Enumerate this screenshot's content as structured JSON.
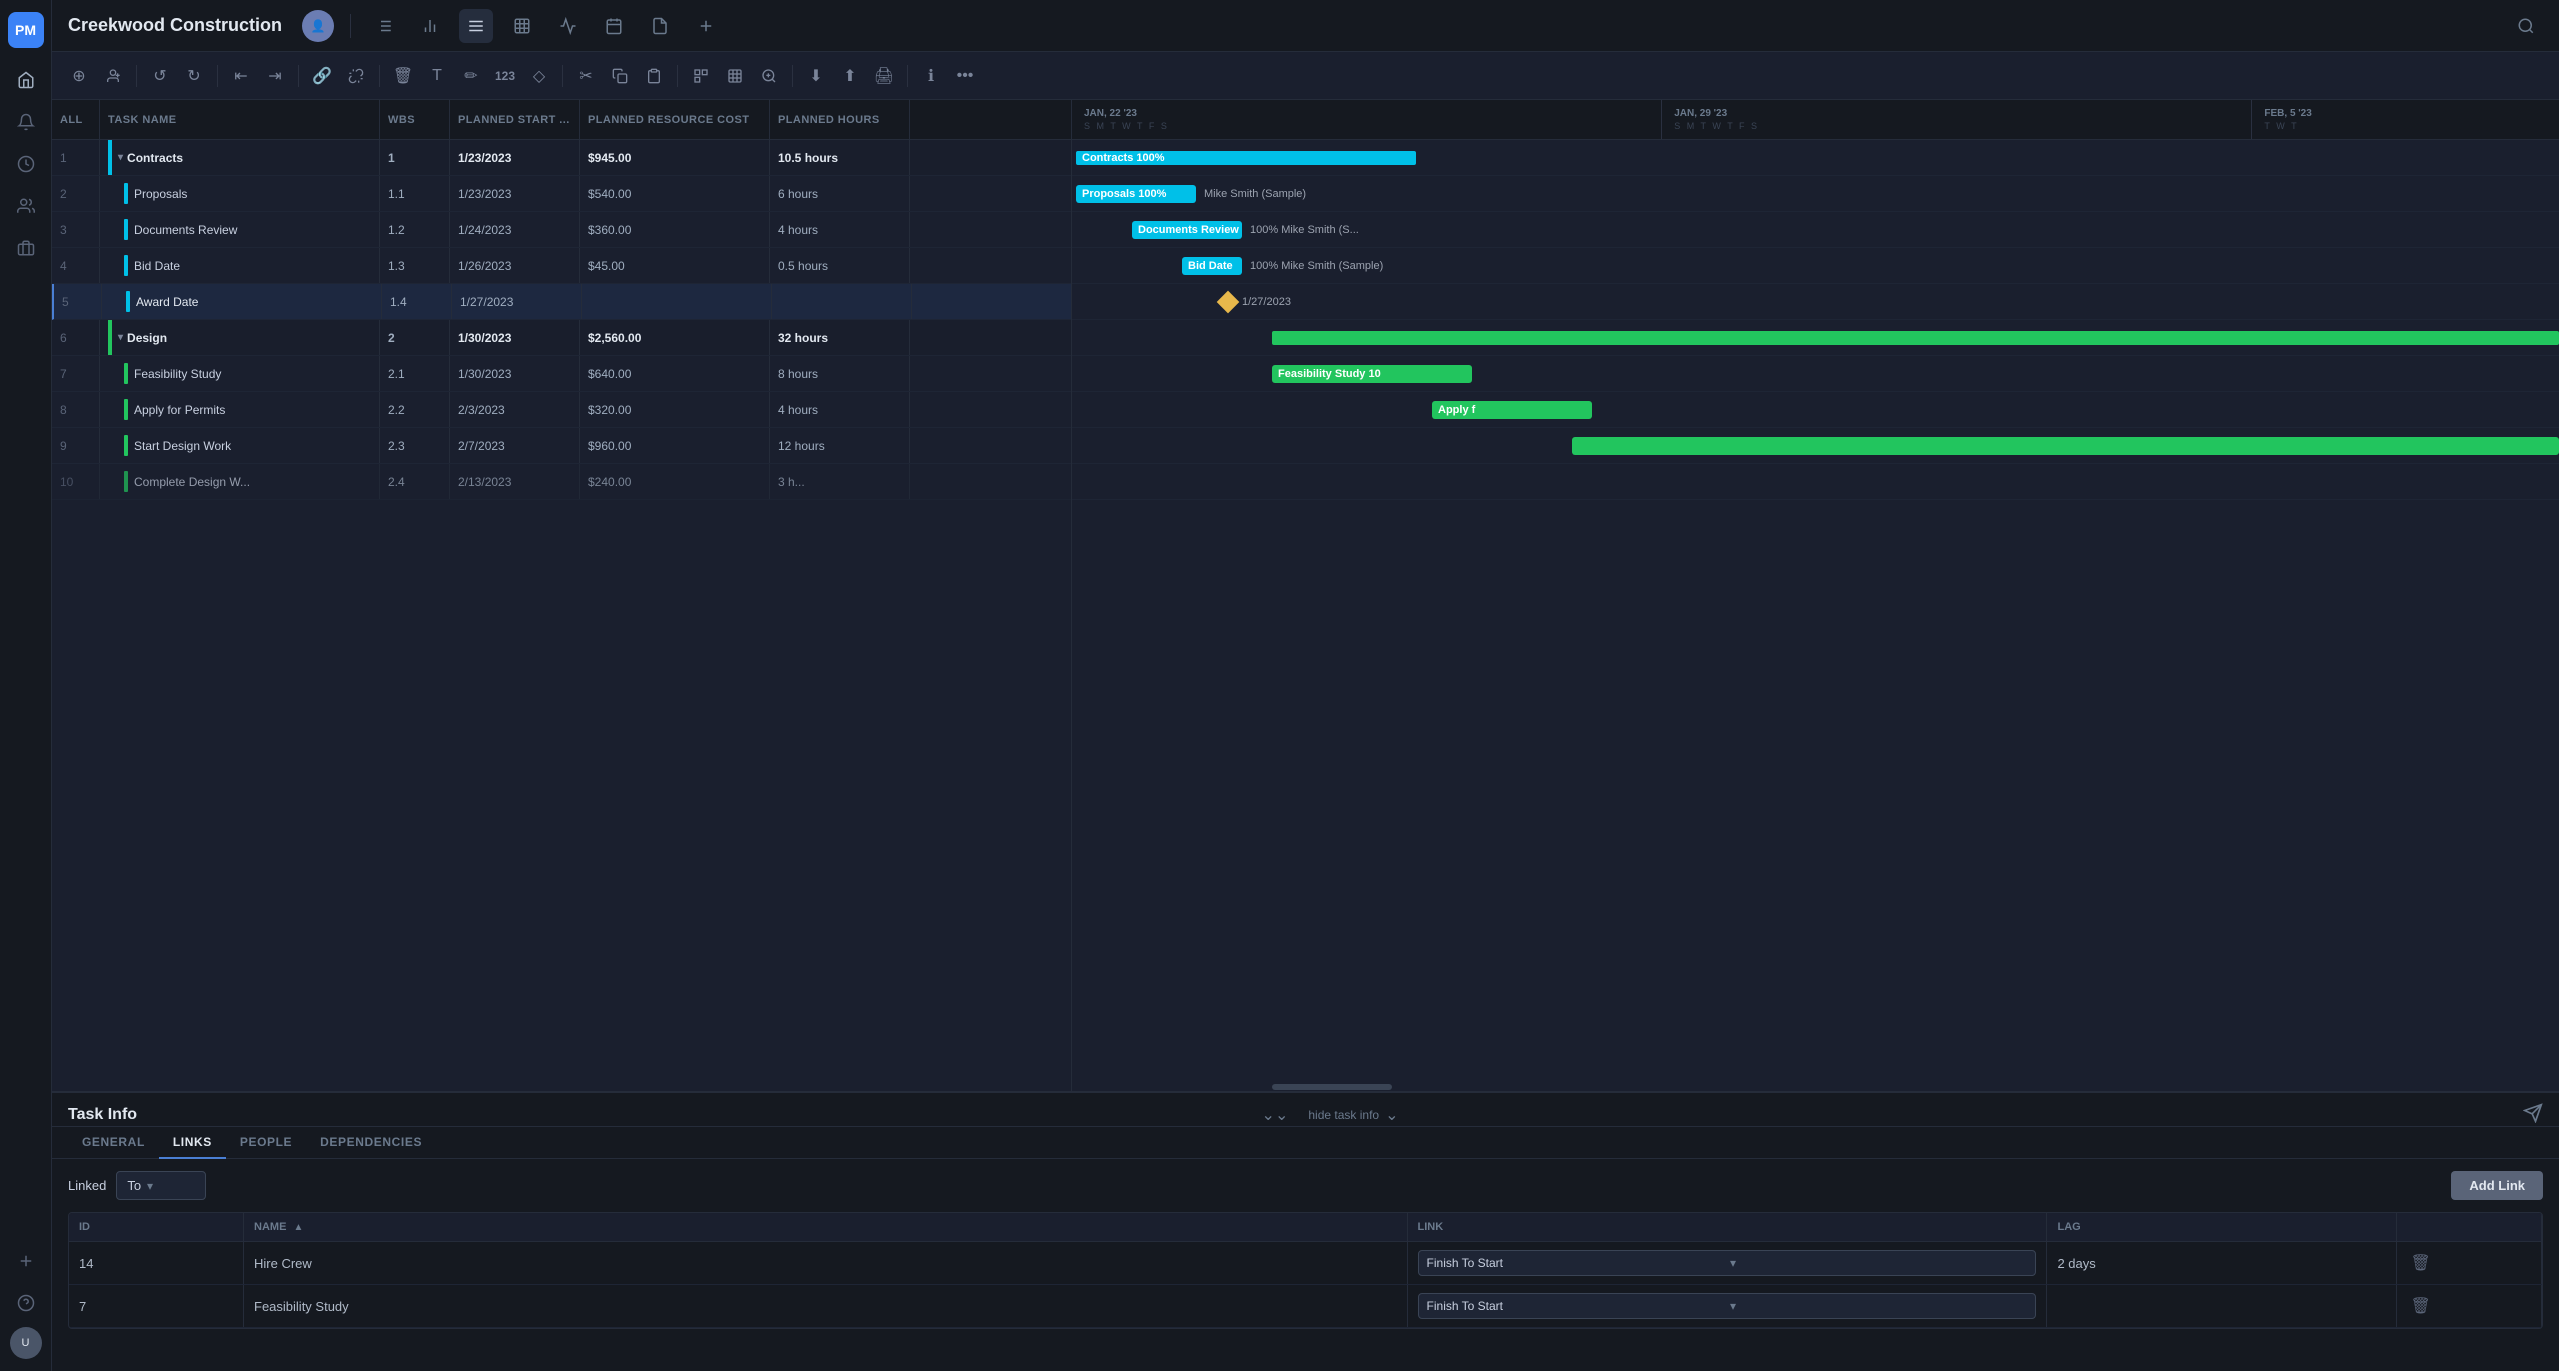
{
  "app": {
    "title": "Creekwood Construction",
    "logo": "PM"
  },
  "topnav": {
    "icons": [
      "list",
      "bar-chart",
      "menu",
      "table",
      "wave",
      "calendar",
      "file",
      "plus",
      "search"
    ]
  },
  "toolbar": {
    "groups": [
      [
        "plus-circle",
        "user-plus"
      ],
      [
        "undo",
        "redo"
      ],
      [
        "indent-left",
        "indent-right"
      ],
      [
        "link",
        "unlink"
      ],
      [
        "trash",
        "text",
        "highlight",
        "123",
        "diamond"
      ],
      [
        "cut",
        "copy",
        "paste"
      ],
      [
        "chain",
        "grid",
        "delete"
      ],
      [
        "zoom-in",
        "zoom-out"
      ],
      [
        "download",
        "upload",
        "print"
      ],
      [
        "info",
        "more"
      ]
    ]
  },
  "table": {
    "headers": {
      "all": "ALL",
      "taskName": "TASK NAME",
      "wbs": "WBS",
      "plannedStart": "PLANNED START ...",
      "plannedCost": "PLANNED RESOURCE COST",
      "plannedHours": "PLANNED HOURS"
    },
    "rows": [
      {
        "id": 1,
        "name": "Contracts",
        "wbs": "1",
        "start": "1/23/2023",
        "cost": "$945.00",
        "hours": "10.5 hours",
        "isGroup": true,
        "color": "cyan"
      },
      {
        "id": 2,
        "name": "Proposals",
        "wbs": "1.1",
        "start": "1/23/2023",
        "cost": "$540.00",
        "hours": "6 hours",
        "indent": 1,
        "color": "cyan"
      },
      {
        "id": 3,
        "name": "Documents Review",
        "wbs": "1.2",
        "start": "1/24/2023",
        "cost": "$360.00",
        "hours": "4 hours",
        "indent": 1,
        "color": "cyan"
      },
      {
        "id": 4,
        "name": "Bid Date",
        "wbs": "1.3",
        "start": "1/26/2023",
        "cost": "$45.00",
        "hours": "0.5 hours",
        "indent": 1,
        "color": "cyan"
      },
      {
        "id": 5,
        "name": "Award Date",
        "wbs": "1.4",
        "start": "1/27/2023",
        "cost": "",
        "hours": "",
        "indent": 1,
        "color": "cyan",
        "selected": true
      },
      {
        "id": 6,
        "name": "Design",
        "wbs": "2",
        "start": "1/30/2023",
        "cost": "$2,560.00",
        "hours": "32 hours",
        "isGroup": true,
        "color": "green"
      },
      {
        "id": 7,
        "name": "Feasibility Study",
        "wbs": "2.1",
        "start": "1/30/2023",
        "cost": "$640.00",
        "hours": "8 hours",
        "indent": 1,
        "color": "green"
      },
      {
        "id": 8,
        "name": "Apply for Permits",
        "wbs": "2.2",
        "start": "2/3/2023",
        "cost": "$320.00",
        "hours": "4 hours",
        "indent": 1,
        "color": "green"
      },
      {
        "id": 9,
        "name": "Start Design Work",
        "wbs": "2.3",
        "start": "2/7/2023",
        "cost": "$960.00",
        "hours": "12 hours",
        "indent": 1,
        "color": "green"
      },
      {
        "id": 10,
        "name": "Complete Design W...",
        "wbs": "2.4",
        "start": "2/13/2023",
        "cost": "$240.00",
        "hours": "3 h...",
        "indent": 1,
        "color": "green"
      }
    ]
  },
  "gantt": {
    "weeks": [
      {
        "label": "JAN, 22 '23",
        "days": "S M T W T F S"
      },
      {
        "label": "JAN, 29 '23",
        "days": "S M T W T F S"
      },
      {
        "label": "FEB, 5 '23",
        "days": "T W T"
      }
    ]
  },
  "taskInfo": {
    "title": "Task Info",
    "hideLabel": "hide task info",
    "tabs": [
      "GENERAL",
      "LINKS",
      "PEOPLE",
      "DEPENDENCIES"
    ],
    "activeTab": "LINKS"
  },
  "links": {
    "linkedLabel": "Linked",
    "direction": "To",
    "addLinkLabel": "Add Link",
    "tableHeaders": {
      "id": "ID",
      "name": "NAME",
      "link": "LINK",
      "lag": "LAG"
    },
    "rows": [
      {
        "id": 14,
        "name": "Hire Crew",
        "link": "Finish To Start",
        "lag": "2 days"
      },
      {
        "id": 7,
        "name": "Feasibility Study",
        "link": "Finish To Start",
        "lag": ""
      }
    ]
  }
}
